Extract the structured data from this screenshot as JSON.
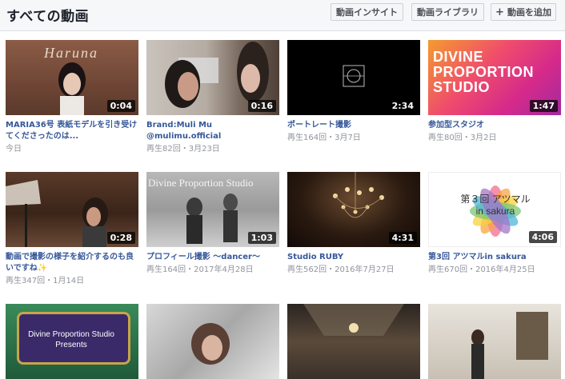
{
  "header": {
    "title": "すべての動画",
    "buttons": {
      "insights": "動画インサイト",
      "library": "動画ライブラリ",
      "add": "動画を追加"
    }
  },
  "videos": [
    {
      "title": "MARIA36号 表紙モデルを引き受けてくださったのは...",
      "meta": "今日",
      "duration": "0:04",
      "thumb_text": "Haruna"
    },
    {
      "title": "Brand:Muli Mu @mulimu.official Styling:Z&Muli Model:Arina...",
      "meta": "再生82回・3月23日",
      "duration": "0:16"
    },
    {
      "title": "ポートレート撮影",
      "meta": "再生164回・3月7日",
      "duration": "2:34"
    },
    {
      "title": "参加型スタジオ",
      "meta": "再生80回・3月2日",
      "duration": "1:47",
      "thumb_text": "DIVINE PROPORTION STUDIO"
    },
    {
      "title": "動画で撮影の様子を紹介するのも良いですね✨",
      "meta": "再生347回・1月14日",
      "duration": "0:28"
    },
    {
      "title": "プロフィール撮影 〜dancer〜",
      "meta": "再生164回・2017年4月28日",
      "duration": "1:03",
      "thumb_text": "Divine Proportion Studio"
    },
    {
      "title": "Studio RUBY",
      "meta": "再生562回・2016年7月27日",
      "duration": "4:31"
    },
    {
      "title": "第3回 アツマルin sakura",
      "meta": "再生670回・2016年4月25日",
      "duration": "4:06",
      "thumb_text": "第３回 アツマル in sakura"
    },
    {
      "thumb_text": "Divine Proportion Studio Presents"
    },
    {},
    {},
    {}
  ],
  "colors": {
    "link": "#365899",
    "meta": "#90949c",
    "header_bg": "#f6f7f9"
  }
}
